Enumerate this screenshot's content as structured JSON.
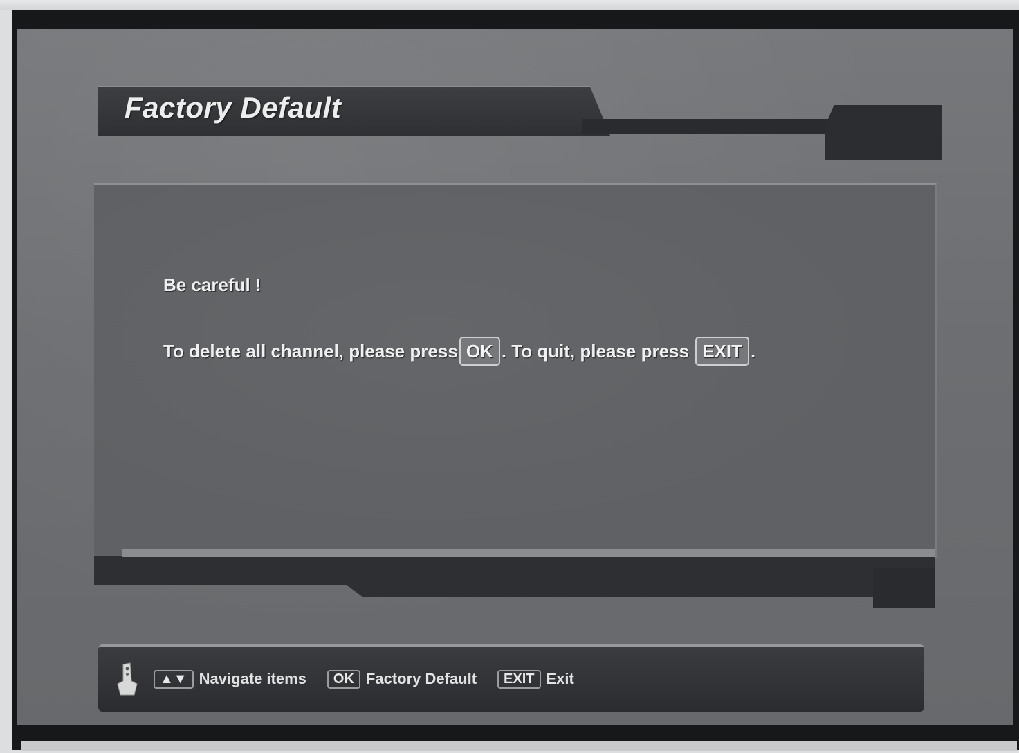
{
  "window": {
    "title": "Factory Default"
  },
  "dialog": {
    "line1": "Be careful !",
    "line2_prefix": "To delete all channel, please press",
    "ok_key": "OK",
    "line2_middle": ". To quit, please press",
    "exit_key": "EXIT",
    "line2_suffix": "."
  },
  "help_bar": {
    "icon": "remote-control-icon",
    "items": [
      {
        "key": "▲▼",
        "label": "Navigate items"
      },
      {
        "key": "OK",
        "label": "Factory Default"
      },
      {
        "key": "EXIT",
        "label": "Exit"
      }
    ]
  },
  "colors": {
    "osd_background": "#6c6e71",
    "panel_dark": "#2f3033",
    "text": "#f0f0f0"
  }
}
